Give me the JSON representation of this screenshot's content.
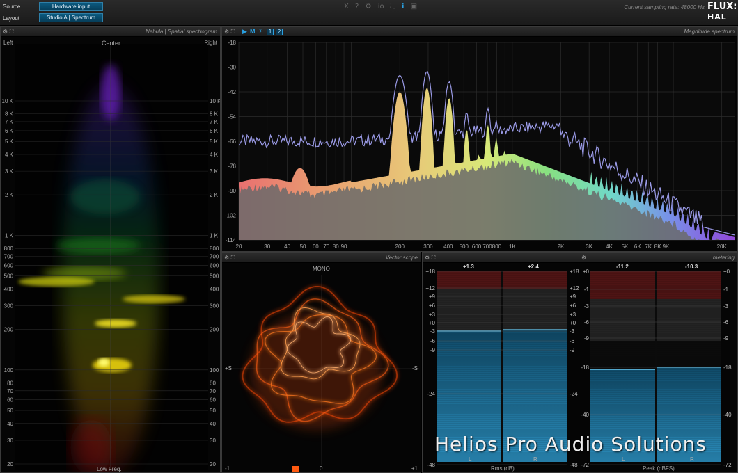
{
  "topbar": {
    "source_label": "Source",
    "source_value": "Hardware input",
    "layout_label": "Layout",
    "layout_value": "Studio A | Spectrum",
    "tool_icons": [
      "X",
      "?",
      "⚙",
      "io",
      "⛶",
      "i",
      "▣"
    ],
    "sampling_rate": "Current sampling rate: 48000 Hz",
    "logo_top": "FLUX:",
    "logo_bottom": "HAL"
  },
  "nebula": {
    "title": "Nebula | Spatial spectrogram",
    "left_label": "Left",
    "center_label": "Center",
    "right_label": "Right",
    "bottom_label": "Low Freq.",
    "freq_labels": [
      "10 K",
      "8 K",
      "7 K",
      "6 K",
      "5 K",
      "4 K",
      "3 K",
      "2 K",
      "1 K",
      "800",
      "700",
      "600",
      "500",
      "400",
      "300",
      "200",
      "100",
      "80",
      "70",
      "60",
      "50",
      "40",
      "30",
      "20"
    ]
  },
  "spectrum": {
    "title": "Magnitude spectrum",
    "toolbar": [
      "▶",
      "M",
      "Σ"
    ],
    "tabs": [
      "1",
      "2"
    ],
    "db_labels": [
      "-18",
      "-30",
      "-42",
      "-54",
      "-66",
      "-78",
      "-90",
      "-102",
      "-114"
    ],
    "freq_labels": [
      "20",
      "30",
      "40",
      "50",
      "60",
      "70",
      "80",
      "90",
      "200",
      "300",
      "400",
      "500",
      "600",
      "700",
      "800",
      "1K",
      "2K",
      "3K",
      "4K",
      "5K",
      "6K",
      "7K",
      "8K",
      "9K",
      "20K"
    ]
  },
  "vectorscope": {
    "title": "Vector scope",
    "top_label": "MONO",
    "left_label": "+S",
    "right_label": "-S",
    "bottom_left": "-1",
    "bottom_center": "0",
    "bottom_right": "+1"
  },
  "metering": {
    "title": "metering",
    "rms": {
      "unit_label": "Rms (dB)",
      "left_value": "+1.3",
      "right_value": "+2.4",
      "left_channel": "L",
      "right_channel": "R",
      "scale": [
        "+18",
        "+12",
        "+9",
        "+6",
        "+3",
        "+0",
        "-3",
        "-6",
        "-9",
        "-24",
        "-48"
      ],
      "level_left_db": -3,
      "level_right_db": -2.5
    },
    "peak": {
      "unit_label": "Peak (dBFS)",
      "left_value": "-11.2",
      "right_value": "-10.3",
      "left_channel": "L",
      "right_channel": "R",
      "scale": [
        "+0",
        "-1",
        "-3",
        "-6",
        "-9",
        "-18",
        "-40",
        "-72"
      ],
      "level_left_db": -19,
      "level_right_db": -18
    }
  },
  "watermark": "Helios Pro Audio Solutions",
  "colors": {
    "accent": "#2aa0e0",
    "button_bg": "#0a4e70",
    "meter_blue": "#1d7aa8",
    "meter_red": "#7a2020",
    "spectrum_line": "#9a9ae6",
    "scope_orange": "#ff6a10"
  }
}
